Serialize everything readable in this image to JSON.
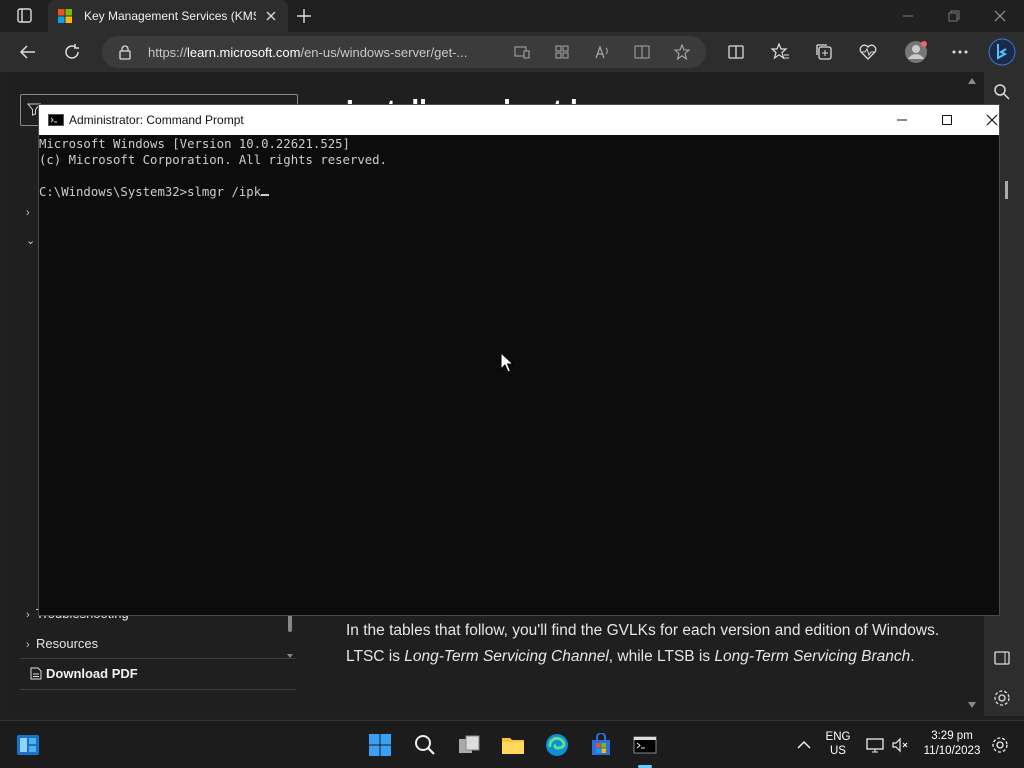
{
  "browser": {
    "tab_title": "Key Management Services (KMS)",
    "url_prefix": "https://",
    "url_domain": "learn.microsoft.com",
    "url_path": "/en-us/windows-server/get-..."
  },
  "page": {
    "heading_partial": "Install your host key",
    "nav_items": [
      {
        "label": "Troubleshooting"
      },
      {
        "label": "Resources"
      }
    ],
    "download_pdf": "Download PDF",
    "article": {
      "text1": "In the tables that follow, you'll find the GVLKs for each version and edition of Windows. LTSC is ",
      "em1": "Long-Term Servicing Channel",
      "text2": ", while LTSB is ",
      "em2": "Long-Term Servicing Branch",
      "text3": "."
    }
  },
  "cmd": {
    "title": "Administrator: Command Prompt",
    "lines": [
      "Microsoft Windows [Version 10.0.22621.525]",
      "(c) Microsoft Corporation. All rights reserved.",
      "",
      "C:\\Windows\\System32>slmgr /ipk"
    ]
  },
  "tray": {
    "lang1": "ENG",
    "lang2": "US",
    "time": "3:29 pm",
    "date": "11/10/2023"
  },
  "colors": {
    "accent": "#60cdff",
    "terminal_bg": "#0c0c0c",
    "terminal_fg": "#cccccc"
  }
}
